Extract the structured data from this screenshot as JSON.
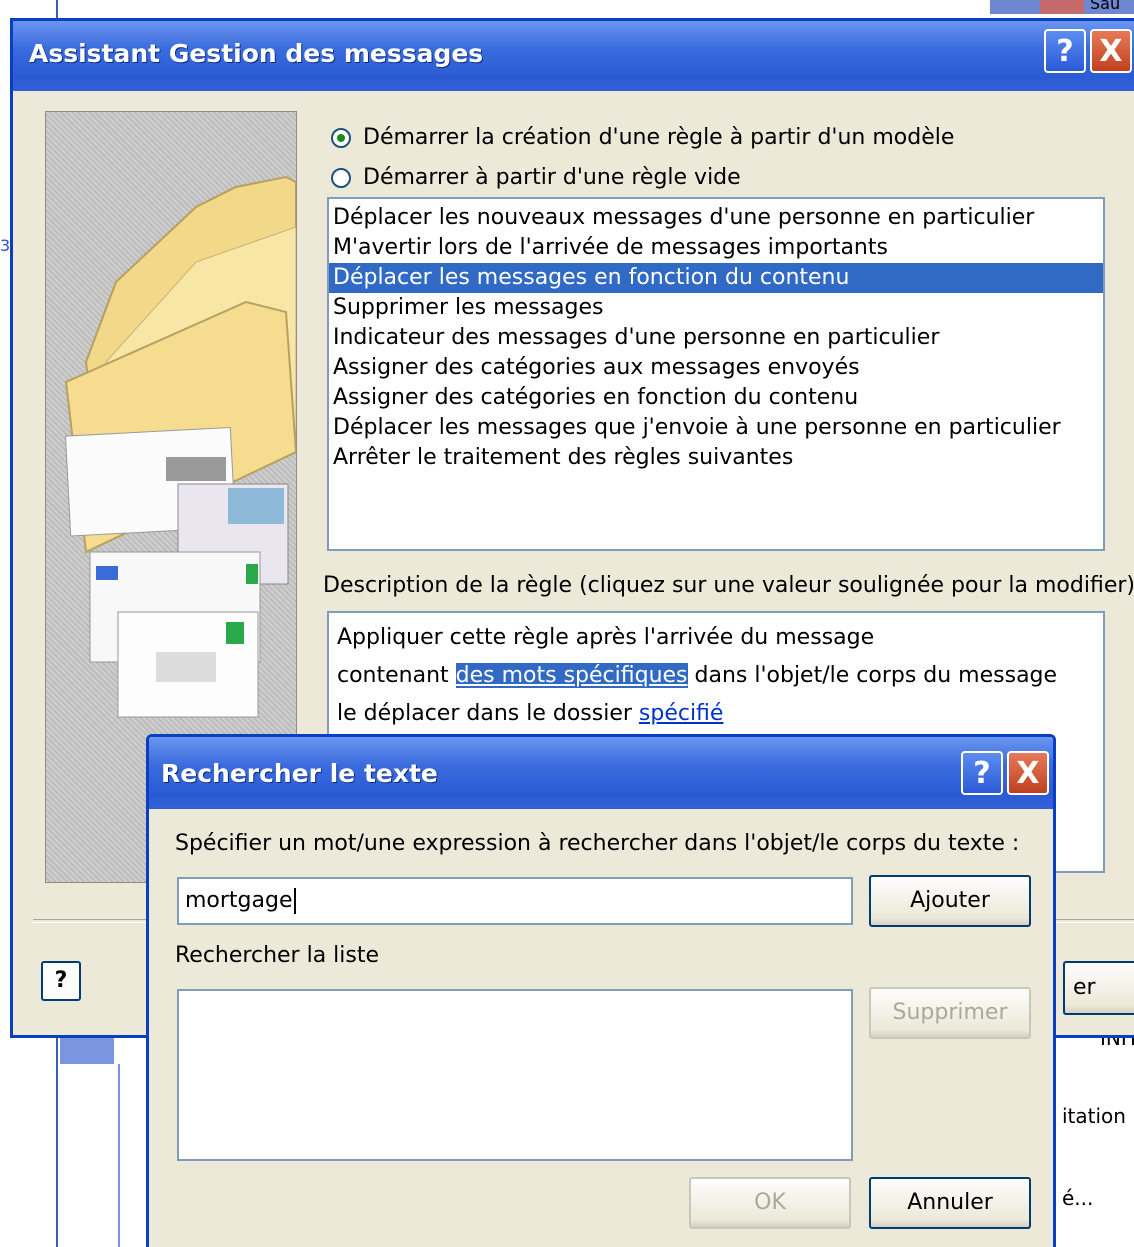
{
  "background": {
    "top_right_fragment": "Sau",
    "right_fragment_1": "INH",
    "right_fragment_2": "itation",
    "right_fragment_3": "é...",
    "left_stray_char": "3"
  },
  "rules_wizard": {
    "title": "Assistant Gestion des messages",
    "help_glyph": "?",
    "close_glyph": "X",
    "radio_template": "Démarrer la création d'une règle à partir d'un modèle",
    "radio_blank": "Démarrer à partir d'une règle vide",
    "templates": [
      "Déplacer les nouveaux messages d'une personne en particulier",
      "M'avertir lors de l'arrivée de messages importants",
      "Déplacer les messages en fonction du contenu",
      "Supprimer les messages",
      "Indicateur des messages d'une personne en particulier",
      "Assigner des catégories aux messages envoyés",
      "Assigner des catégories en fonction du contenu",
      "Déplacer les messages que j'envoie à une personne en particulier",
      "Arrêter le traitement des règles suivantes"
    ],
    "selected_index": 2,
    "description_label": "Description de la règle (cliquez sur une valeur soulignée pour la modifier) :",
    "description": {
      "line1": "Appliquer cette règle après l'arrivée du message",
      "line2_prefix": "contenant ",
      "line2_link": "des mots spécifiques",
      "line2_suffix": " dans l'objet/le corps du message",
      "line3_prefix": "le déplacer dans le dossier ",
      "line3_link": "spécifié"
    },
    "help_button": "?",
    "partial_button": "er"
  },
  "find_text_dialog": {
    "title": "Rechercher le texte",
    "help_glyph": "?",
    "close_glyph": "X",
    "prompt": "Spécifier un mot/une expression à rechercher dans l'objet/le corps du texte :",
    "input_value": "mortgage",
    "add_button": "Ajouter",
    "list_label": "Rechercher la liste",
    "remove_button": "Supprimer",
    "ok_button": "OK",
    "cancel_button": "Annuler"
  }
}
